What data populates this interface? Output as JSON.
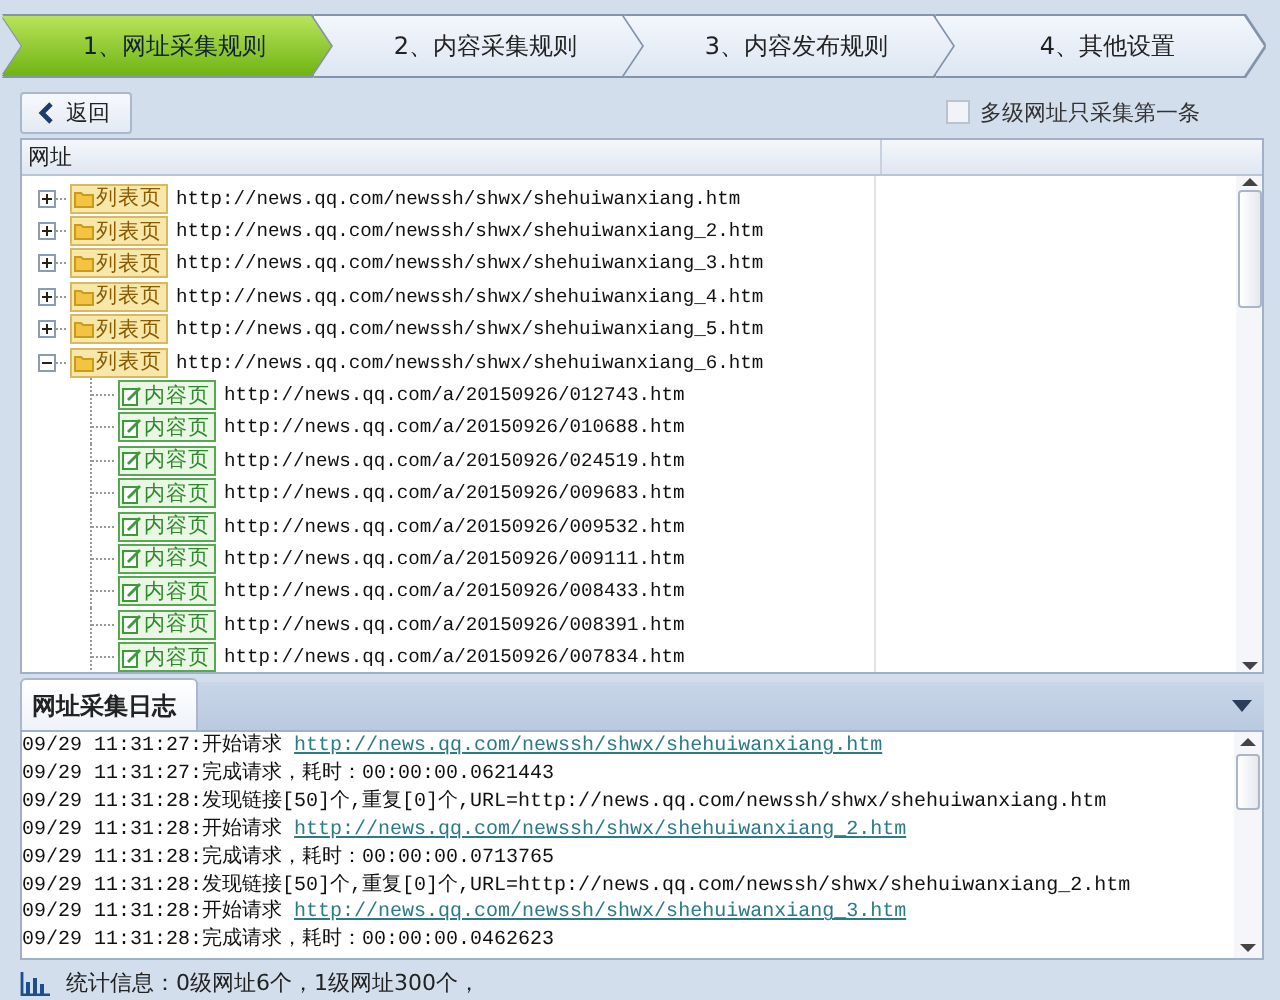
{
  "steps": [
    {
      "label": "1、网址采集规则",
      "selected": true
    },
    {
      "label": "2、内容采集规则",
      "selected": false
    },
    {
      "label": "3、内容发布规则",
      "selected": false
    },
    {
      "label": "4、其他设置",
      "selected": false
    }
  ],
  "toolbar": {
    "back_button": "返回",
    "option": {
      "label": "多级网址只采集第一条",
      "checked": false
    }
  },
  "tree": {
    "columns": [
      "网址"
    ],
    "nodes": [
      {
        "kind": "list",
        "tag": "列表页",
        "url": "http://news.qq.com/newssh/shwx/shehuiwanxiang.htm",
        "expanded": false
      },
      {
        "kind": "list",
        "tag": "列表页",
        "url": "http://news.qq.com/newssh/shwx/shehuiwanxiang_2.htm",
        "expanded": false
      },
      {
        "kind": "list",
        "tag": "列表页",
        "url": "http://news.qq.com/newssh/shwx/shehuiwanxiang_3.htm",
        "expanded": false
      },
      {
        "kind": "list",
        "tag": "列表页",
        "url": "http://news.qq.com/newssh/shwx/shehuiwanxiang_4.htm",
        "expanded": false
      },
      {
        "kind": "list",
        "tag": "列表页",
        "url": "http://news.qq.com/newssh/shwx/shehuiwanxiang_5.htm",
        "expanded": false
      },
      {
        "kind": "list",
        "tag": "列表页",
        "url": "http://news.qq.com/newssh/shwx/shehuiwanxiang_6.htm",
        "expanded": true,
        "children": [
          {
            "kind": "content",
            "tag": "内容页",
            "url": "http://news.qq.com/a/20150926/012743.htm"
          },
          {
            "kind": "content",
            "tag": "内容页",
            "url": "http://news.qq.com/a/20150926/010688.htm"
          },
          {
            "kind": "content",
            "tag": "内容页",
            "url": "http://news.qq.com/a/20150926/024519.htm"
          },
          {
            "kind": "content",
            "tag": "内容页",
            "url": "http://news.qq.com/a/20150926/009683.htm"
          },
          {
            "kind": "content",
            "tag": "内容页",
            "url": "http://news.qq.com/a/20150926/009532.htm"
          },
          {
            "kind": "content",
            "tag": "内容页",
            "url": "http://news.qq.com/a/20150926/009111.htm"
          },
          {
            "kind": "content",
            "tag": "内容页",
            "url": "http://news.qq.com/a/20150926/008433.htm"
          },
          {
            "kind": "content",
            "tag": "内容页",
            "url": "http://news.qq.com/a/20150926/008391.htm"
          },
          {
            "kind": "content",
            "tag": "内容页",
            "url": "http://news.qq.com/a/20150926/007834.htm"
          }
        ]
      }
    ]
  },
  "log": {
    "title": "网址采集日志",
    "lines": [
      {
        "text": "09/29 11:31:27:开始请求",
        "link": "http://news.qq.com/newssh/shwx/shehuiwanxiang.htm"
      },
      {
        "text": "09/29 11:31:27:完成请求，耗时：00:00:00.0621443"
      },
      {
        "text": "09/29 11:31:28:发现链接[50]个,重复[0]个,URL=http://news.qq.com/newssh/shwx/shehuiwanxiang.htm"
      },
      {
        "text": "09/29 11:31:28:开始请求",
        "link": "http://news.qq.com/newssh/shwx/shehuiwanxiang_2.htm"
      },
      {
        "text": "09/29 11:31:28:完成请求，耗时：00:00:00.0713765"
      },
      {
        "text": "09/29 11:31:28:发现链接[50]个,重复[0]个,URL=http://news.qq.com/newssh/shwx/shehuiwanxiang_2.htm"
      },
      {
        "text": "09/29 11:31:28:开始请求",
        "link": "http://news.qq.com/newssh/shwx/shehuiwanxiang_3.htm"
      },
      {
        "text": "09/29 11:31:28:完成请求，耗时：00:00:00.0462623"
      }
    ]
  },
  "status_bar": {
    "text": "统计信息：0级网址6个，1级网址300个，"
  }
}
